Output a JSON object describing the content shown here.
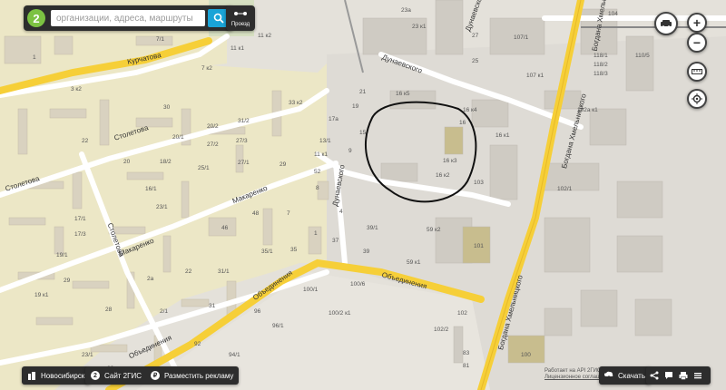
{
  "search": {
    "placeholder": "организации, адреса, маршруты"
  },
  "route": {
    "label": "Проезд"
  },
  "streets": {
    "kurchatova": "Курчатова",
    "stoletova1": "Столетова",
    "stoletova2": "Столетова",
    "stoletova3": "Столетова",
    "makarenko1": "Макаренко",
    "makarenko2": "Макаренко",
    "dunaevskogo1": "Дунаевского",
    "dunaevskogo2": "Дунаевского",
    "dunaevskogo3": "Дунаевского",
    "obedineniya1": "Объединения",
    "obedineniya2": "Объединения",
    "obedineniya3": "Объединения",
    "khmelnitskogo1": "Богдана Хмельницкого",
    "khmelnitskogo2": "Богдана Хмельницкого",
    "khmelnitskogo3": "Богдана Хмельницкого"
  },
  "house_numbers": {
    "h1": "1",
    "h2": "7/1",
    "h3": "7 к2",
    "h4": "3 к2",
    "h5": "11 к1",
    "h6": "11 к2",
    "h7": "33 к2",
    "h8": "30",
    "h9": "22",
    "h10": "20/1",
    "h11": "20/2",
    "h12": "27/2",
    "h13": "27/3",
    "h14": "31/2",
    "h15": "20",
    "h16": "18/2",
    "h17": "25/1",
    "h18": "27/1",
    "h19": "29",
    "h20": "16/1",
    "h21": "23/1",
    "h22": "17/1",
    "h23": "17/3",
    "h24": "19/1",
    "h25": "46",
    "h26": "48",
    "h27": "35/1",
    "h28": "35",
    "h29": "52",
    "h30": "8",
    "h31": "7",
    "h32": "2а",
    "h33": "22",
    "h34": "31/1",
    "h35": "29",
    "h36": "19 к1",
    "h37": "28",
    "h38": "2/1",
    "h39": "31",
    "h40": "21",
    "h41": "19",
    "h42": "17а",
    "h43": "15",
    "h44": "13/1",
    "h45": "11 к1",
    "h46": "9",
    "h47": "4",
    "h48": "1",
    "h49": "37",
    "h50": "39/1",
    "h51": "39",
    "h52": "23а",
    "h53": "23 к1",
    "h54": "27",
    "h55": "25",
    "h56": "16 к5",
    "h57": "16 к4",
    "h58": "16",
    "h59": "16 к1",
    "h60": "16 к3",
    "h61": "16 к2",
    "h62": "103",
    "h63": "59 к2",
    "h64": "59 к1",
    "h65": "101",
    "h66": "100/6",
    "h67": "100/1",
    "h68": "100/2 к1",
    "h69": "96",
    "h70": "96/1",
    "h71": "94/1",
    "h72": "92",
    "h73": "23/1",
    "h74": "82",
    "h75": "102",
    "h76": "102/2",
    "h77": "83",
    "h78": "81",
    "h79": "100",
    "h80": "104",
    "h81": "107/1",
    "h82": "107 к1",
    "h83": "118/1",
    "h84": "118/2",
    "h85": "118/3",
    "h86": "110/5",
    "h87": "102а к1",
    "h88": "102/1"
  },
  "controls": {
    "zoom_in": "+",
    "zoom_out": "−"
  },
  "bottom": {
    "city": "Новосибирск",
    "site": "Сайт 2ГИС",
    "ad": "Разместить рекламу",
    "download": "Скачать"
  },
  "api_notice": {
    "line1": "Работает на API 2ГИС",
    "line2": "Лицензионное соглашение"
  }
}
